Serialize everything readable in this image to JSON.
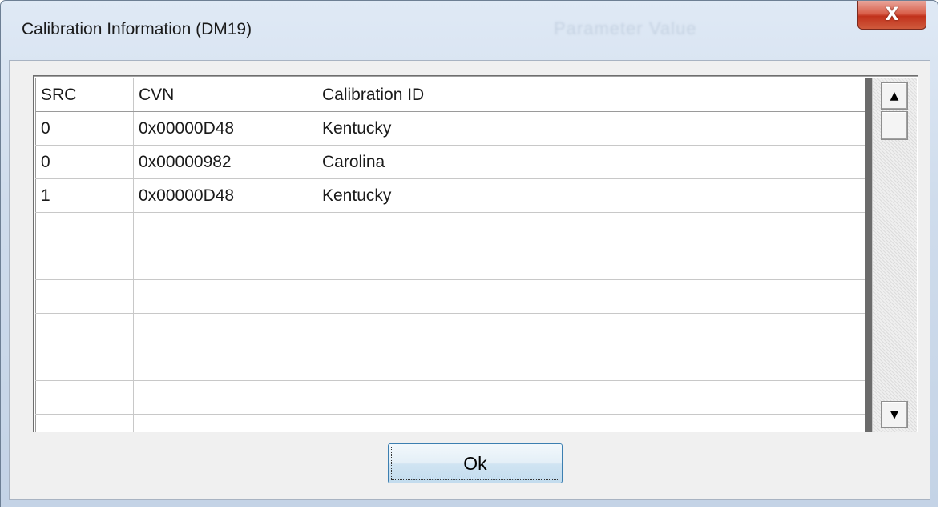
{
  "window": {
    "title": "Calibration Information (DM19)",
    "background_ghost_text": "Parameter Value",
    "close_label": "X"
  },
  "grid": {
    "columns": [
      "SRC",
      "CVN",
      "Calibration ID"
    ],
    "rows": [
      [
        "0",
        "0x00000D48",
        "Kentucky"
      ],
      [
        "0",
        "0x00000982",
        "Carolina"
      ],
      [
        "1",
        "0x00000D48",
        "Kentucky"
      ],
      [
        "",
        "",
        ""
      ],
      [
        "",
        "",
        ""
      ],
      [
        "",
        "",
        ""
      ],
      [
        "",
        "",
        ""
      ],
      [
        "",
        "",
        ""
      ],
      [
        "",
        "",
        ""
      ],
      [
        "",
        "",
        ""
      ]
    ]
  },
  "scrollbar": {
    "up_icon": "▲",
    "down_icon": "▼"
  },
  "ok_button": {
    "label": "Ok"
  }
}
